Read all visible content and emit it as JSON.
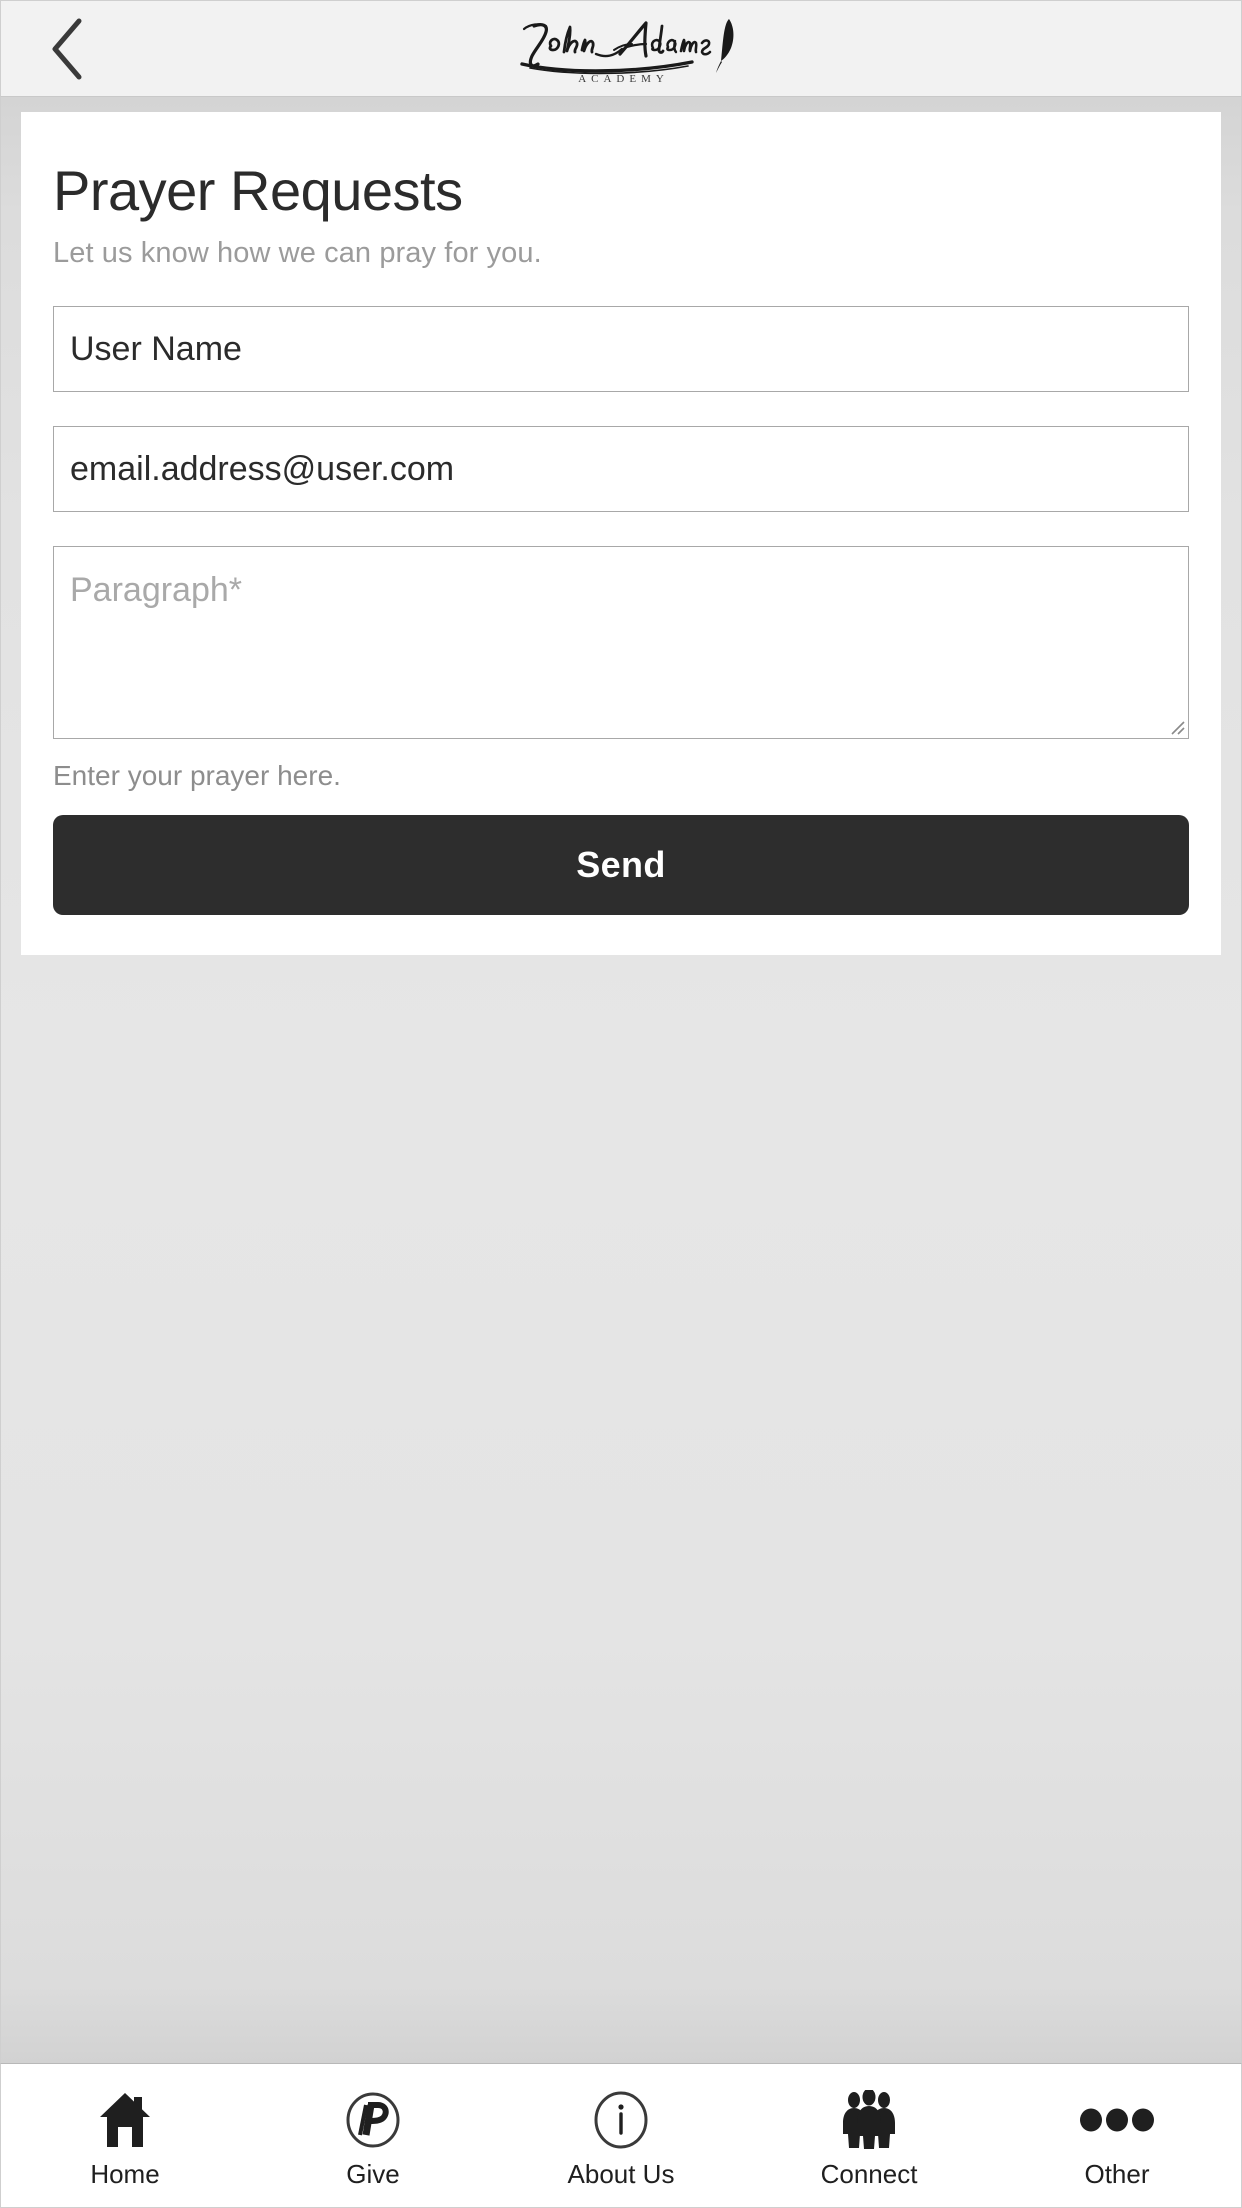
{
  "navbar": {
    "back_icon": "chevron-left-icon",
    "brand_name": "John Adams",
    "brand_subtitle": "ACADEMY"
  },
  "main": {
    "title": "Prayer Requests",
    "subtitle": "Let us know how we can pray for you.",
    "fields": {
      "name": {
        "value": "User Name",
        "placeholder": "User Name"
      },
      "email": {
        "value": "email.address@user.com",
        "placeholder": "email.address@user.com"
      },
      "message": {
        "value": "",
        "placeholder": "Paragraph*"
      }
    },
    "helper_text": "Enter your prayer here.",
    "submit_label": "Send"
  },
  "tabbar": {
    "items": [
      {
        "label": "Home",
        "icon": "house-icon"
      },
      {
        "label": "Give",
        "icon": "circled-p-icon"
      },
      {
        "label": "About Us",
        "icon": "info-circle-icon"
      },
      {
        "label": "Connect",
        "icon": "people-icon"
      },
      {
        "label": "Other",
        "icon": "ellipsis-icon"
      }
    ]
  },
  "colors": {
    "accent_dark": "#2d2d2d",
    "page_background": "#e6e6e6",
    "navbar_background": "#f2f2f2",
    "card_background": "#ffffff",
    "muted_text": "#9b9b9b",
    "border": "#a8a8a8"
  }
}
